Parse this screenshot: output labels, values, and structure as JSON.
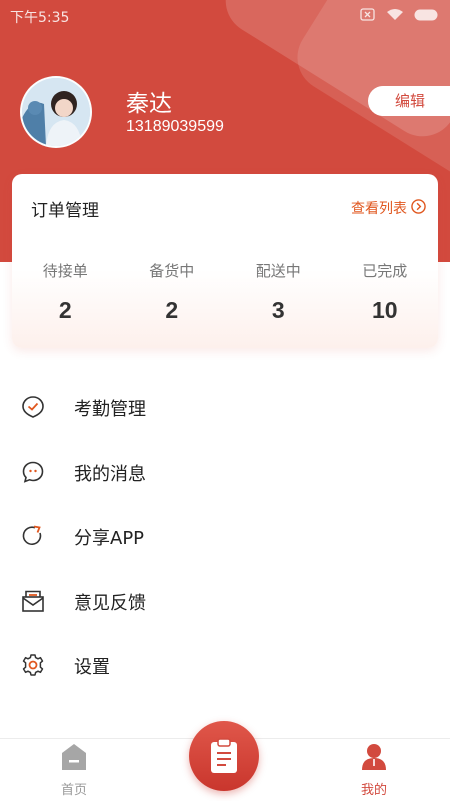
{
  "status_bar": {
    "time": "下午5:35"
  },
  "profile": {
    "name": "秦达",
    "phone": "13189039599",
    "edit_label": "编辑"
  },
  "orders": {
    "title": "订单管理",
    "view_list": "查看列表",
    "stats": [
      {
        "label": "待接单",
        "value": "2"
      },
      {
        "label": "备货中",
        "value": "2"
      },
      {
        "label": "配送中",
        "value": "3"
      },
      {
        "label": "已完成",
        "value": "10"
      }
    ]
  },
  "menu": [
    {
      "label": "考勤管理",
      "icon": "attendance-check-icon"
    },
    {
      "label": "我的消息",
      "icon": "message-bubble-icon"
    },
    {
      "label": "分享APP",
      "icon": "share-refresh-icon"
    },
    {
      "label": "意见反馈",
      "icon": "feedback-envelope-icon"
    },
    {
      "label": "设置",
      "icon": "gear-icon"
    }
  ],
  "tabbar": {
    "home_label": "首页",
    "mine_label": "我的",
    "center_icon": "clipboard-icon"
  },
  "colors": {
    "brand": "#d24a3e",
    "accent_orange": "#e0571f",
    "inactive_gray": "#9a9a9a"
  }
}
